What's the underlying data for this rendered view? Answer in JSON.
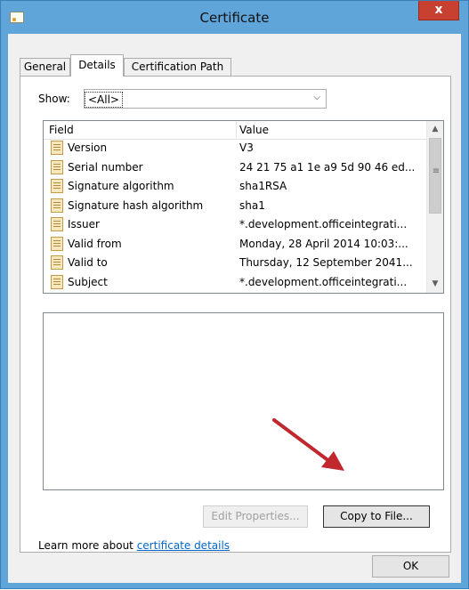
{
  "window": {
    "title": "Certificate",
    "close_glyph": "x"
  },
  "tabs": [
    {
      "label": "General",
      "active": false
    },
    {
      "label": "Details",
      "active": true
    },
    {
      "label": "Certification Path",
      "active": false
    }
  ],
  "show": {
    "label": "Show:",
    "selected": "<All>"
  },
  "list": {
    "columns": [
      "Field",
      "Value"
    ],
    "rows": [
      {
        "field": "Version",
        "value": "V3"
      },
      {
        "field": "Serial number",
        "value": "24 21 75 a1 1e a9 5d 90 46 ed..."
      },
      {
        "field": "Signature algorithm",
        "value": "sha1RSA"
      },
      {
        "field": "Signature hash algorithm",
        "value": "sha1"
      },
      {
        "field": "Issuer",
        "value": "*.development.officeintegrati..."
      },
      {
        "field": "Valid from",
        "value": "Monday, 28 April 2014 10:03:..."
      },
      {
        "field": "Valid to",
        "value": "Thursday, 12 September 2041..."
      },
      {
        "field": "Subject",
        "value": "*.development.officeintegrati..."
      }
    ],
    "row_icon": "certificate-field-icon"
  },
  "buttons": {
    "edit_properties": "Edit Properties...",
    "copy_to_file": "Copy to File...",
    "ok": "OK"
  },
  "learn_more": {
    "prefix": "Learn more about ",
    "link": "certificate details"
  },
  "annotation": {
    "arrow_color": "#c0282e"
  }
}
